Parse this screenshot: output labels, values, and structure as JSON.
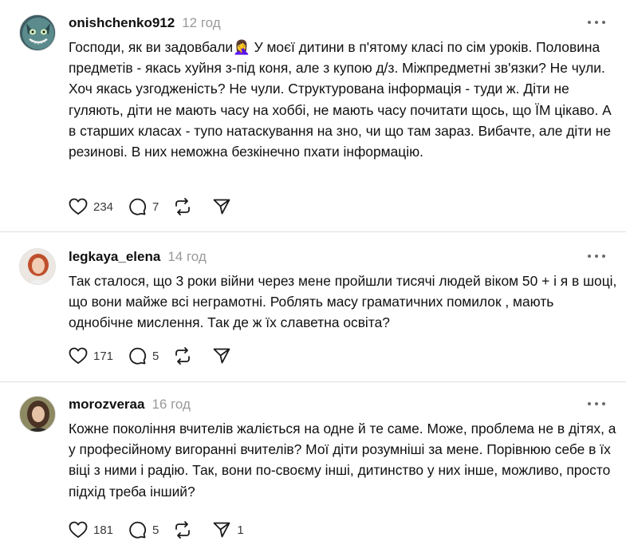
{
  "comments": [
    {
      "username": "onishchenko912",
      "time": "12 год",
      "avatar": "cat-avatar",
      "text": "Господи, як ви задовбали🤦‍♀️ У моєї дитини в п'ятому класі по сім уроків. Половина предметів - якась хуйня з-під коня, але з купою д/з. Міжпредметні зв'язки? Не чули. Хоч якась узгодженість? Не чули. Структурована інформація - туди ж. Діти не гуляють, діти не мають часу на хоббі, не мають часу почитати щось, що ЇМ цікаво. А в старших класах - тупо натаскування на зно, чи що там зараз. Вибачте, але діти не резинові. В них неможна безкінечно пхати інформацію.",
      "likes": "234",
      "replies": "7",
      "reposts": "",
      "shares": ""
    },
    {
      "username": "legkaya_elena",
      "time": "14 год",
      "avatar": "woman-photo-avatar",
      "text": "Так сталося, що 3 роки війни через мене пройшли тисячі людей віком 50 + і я в шоці, що вони майже всі неграмотні. Роблять масу граматичних помилок , мають однобічне мислення. Так де ж їх славетна освіта?",
      "likes": "171",
      "replies": "5",
      "reposts": "",
      "shares": ""
    },
    {
      "username": "morozveraa",
      "time": "16 год",
      "avatar": "woman-photo-avatar",
      "text": "Кожне покоління вчителів жаліється на одне й те саме. Може, проблема не в дітях, а у професійному вигоранні вчителів? Мої діти розумніші за мене. Порівнюю себе в їх віці з ними і радію. Так, вони по-своєму інші, дитинство у них інше, можливо, просто підхід треба інший?",
      "likes": "181",
      "replies": "5",
      "reposts": "",
      "shares": "1"
    }
  ],
  "icons": {
    "like": "heart-icon",
    "reply": "comment-bubble-icon",
    "repost": "repost-icon",
    "share": "send-icon",
    "more": "more-dots-icon"
  },
  "colors": {
    "text": "#101010",
    "muted": "#999999",
    "divider": "#e0e0e0",
    "icon": "#1a1a1a"
  }
}
